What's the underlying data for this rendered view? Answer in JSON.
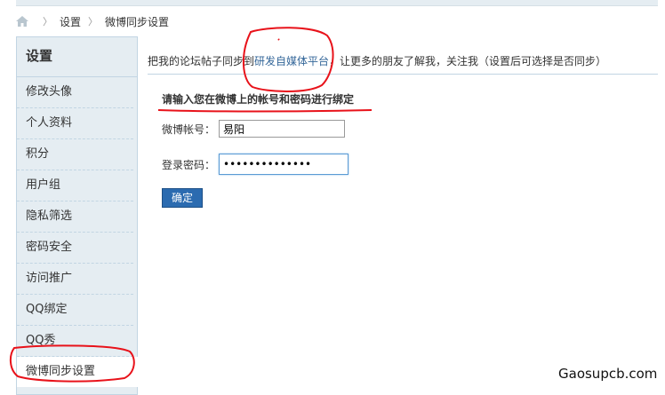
{
  "breadcrumb": {
    "items": [
      "设置",
      "微博同步设置"
    ]
  },
  "sidebar": {
    "title": "设置",
    "items": [
      {
        "label": "修改头像"
      },
      {
        "label": "个人资料"
      },
      {
        "label": "积分"
      },
      {
        "label": "用户组"
      },
      {
        "label": "隐私筛选"
      },
      {
        "label": "密码安全"
      },
      {
        "label": "访问推广"
      },
      {
        "label": "QQ绑定"
      },
      {
        "label": "QQ秀"
      },
      {
        "label": "微博同步设置"
      }
    ]
  },
  "main": {
    "intro_prefix": "把我的论坛帖子同步到",
    "intro_link": "研发自媒体平台",
    "intro_suffix": "，让更多的朋友了解我，关注我（设置后可选择是否同步）",
    "bind_title": "请输入您在微博上的帐号和密码进行绑定",
    "account_label": "微博帐号：",
    "account_value": "易阳",
    "password_label": "登录密码：",
    "password_value": "••••••••••••••",
    "confirm_label": "确定"
  },
  "watermark": "Gaosupcb.com",
  "annotation_color": "#e8121a"
}
